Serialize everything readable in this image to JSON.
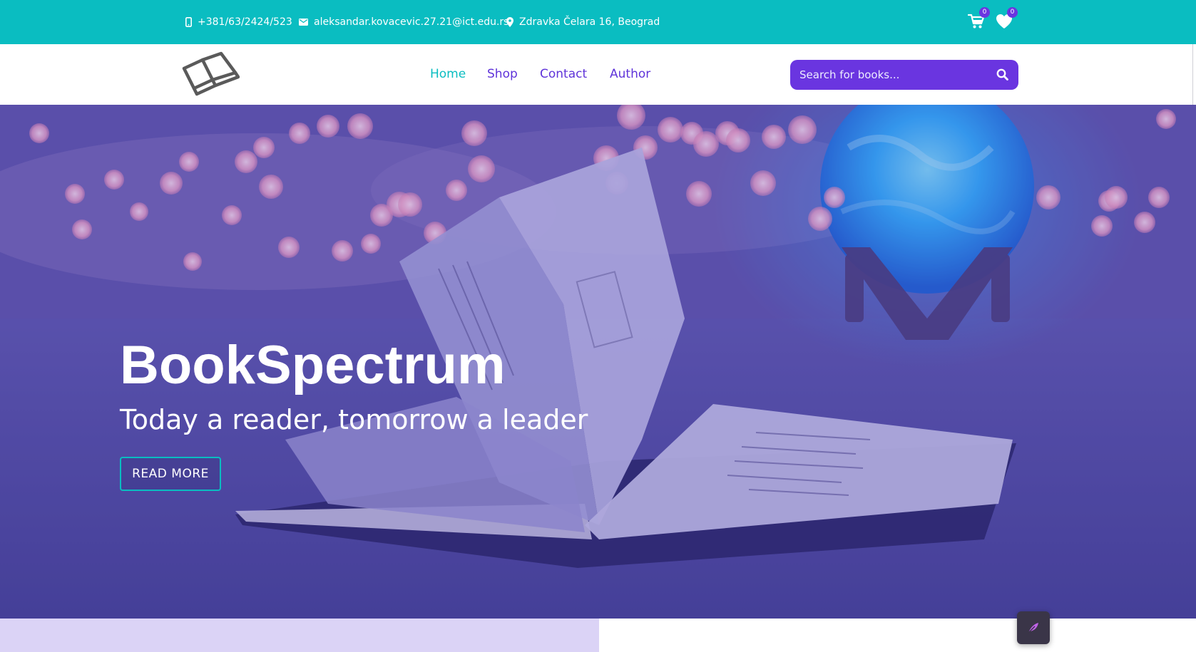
{
  "topbar": {
    "phone": "+381/63/2424/523",
    "email": "aleksandar.kovacevic.27.21@ict.edu.rs",
    "address": "Zdravka Čelara 16, Beograd",
    "cart_count": "0",
    "wishlist_count": "0",
    "background_color": "#0abdc1",
    "icons": [
      "phone-icon",
      "mail-icon",
      "location-pin-icon",
      "cart-icon",
      "heart-icon"
    ]
  },
  "navbar": {
    "logo_icon": "open-book-logo-icon",
    "links": [
      {
        "label": "Home",
        "active": true
      },
      {
        "label": "Shop",
        "active": false
      },
      {
        "label": "Contact",
        "active": false
      },
      {
        "label": "Author",
        "active": false
      }
    ],
    "search": {
      "placeholder": "Search for books...",
      "value": "",
      "icon": "search-icon",
      "color": "#6a35e0"
    },
    "active_color": "#0abdc1",
    "link_color": "#5f33d9"
  },
  "hero": {
    "title": "BookSpectrum",
    "subtitle": "Today a reader, tomorrow a leader",
    "button_label": "READ MORE",
    "button_border_color": "#0abdc1"
  },
  "floating_button": {
    "icon": "feather-icon"
  }
}
